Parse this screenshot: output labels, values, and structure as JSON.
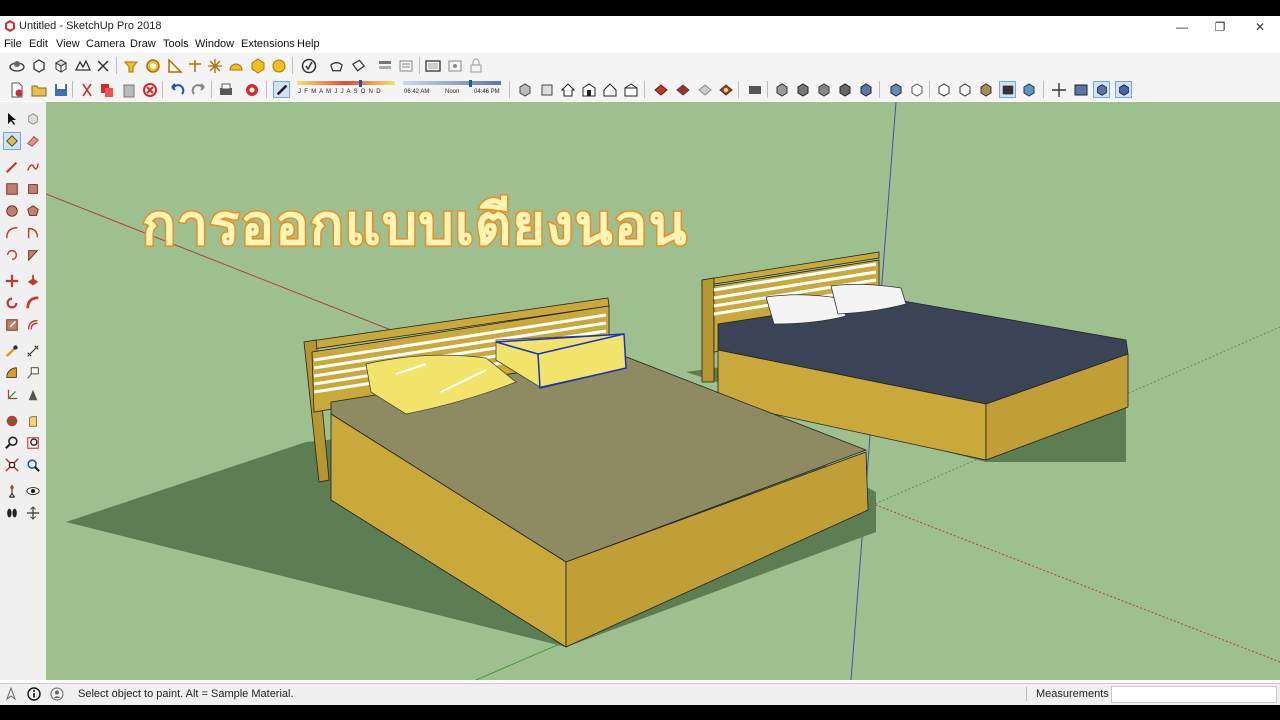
{
  "window": {
    "title": "Untitled - SketchUp Pro 2018"
  },
  "menu": {
    "items": [
      "File",
      "Edit",
      "View",
      "Camera",
      "Draw",
      "Tools",
      "Window",
      "Extensions",
      "Help"
    ]
  },
  "toolbar_top": {
    "icons": [
      "camera-orbit-icon",
      "component-icon",
      "box-icon",
      "sandbox-icon",
      "scissors-icon",
      "select-icon",
      "circle-icon",
      "protractor-icon",
      "axes-icon",
      "star-icon",
      "dimension-icon",
      "follow-me-icon",
      "shadows-icon",
      "teapot-icon",
      "paint-bucket-icon",
      "layers-icon",
      "outliner-icon",
      "scenes-icon",
      "section-icon",
      "lock-icon"
    ]
  },
  "toolbar_second": {
    "shadow_months": "J F M A M J J A S O N D",
    "shadow_time_start": "06:42 AM",
    "shadow_time_noon": "Noon",
    "shadow_time_end": "04:46 PM",
    "icons": [
      "new-file-icon",
      "open-folder-icon",
      "save-icon",
      "cut-icon",
      "copy-icon",
      "paste-icon",
      "erase-icon",
      "undo-icon",
      "redo-icon",
      "print-icon",
      "model-info-icon",
      "shadow-toggle-icon"
    ]
  },
  "left_toolbar": {
    "icons": [
      "select-arrow-icon",
      "make-component-icon",
      "paint-bucket-icon",
      "eraser-icon",
      "line-pencil-icon",
      "freehand-icon",
      "rectangle-icon",
      "rotated-rectangle-icon",
      "circle-icon",
      "polygon-icon",
      "arc-icon",
      "pie-icon",
      "two-point-arc-icon",
      "three-point-arc-icon",
      "move-icon",
      "push-pull-icon",
      "rotate-icon",
      "follow-me-icon",
      "scale-icon",
      "offset-icon",
      "tape-measure-icon",
      "dimension-icon",
      "protractor-icon",
      "text-icon",
      "axes-icon",
      "3d-text-icon",
      "orbit-icon",
      "pan-icon",
      "zoom-icon",
      "zoom-window-icon",
      "zoom-extents-icon",
      "previous-view-icon",
      "position-camera-icon",
      "look-around-icon",
      "walk-icon",
      "section-plane-icon"
    ]
  },
  "overlay": {
    "title_text": "การออกแบบเตียงนอน"
  },
  "status": {
    "message": "Select object to paint. Alt = Sample Material.",
    "measurements_label": "Measurements",
    "measurements_value": ""
  },
  "colors": {
    "viewport_bg": "#9ec08e",
    "wood": "#c9a93a",
    "mattress_left": "#8e8a62",
    "mattress_right": "#3b4356",
    "pillow_yellow": "#f2e46a",
    "pillow_white": "#f4f4f4",
    "title_fill": "#fff6b6",
    "title_stroke": "#f08a1e",
    "selection": "#1a2fc8"
  }
}
